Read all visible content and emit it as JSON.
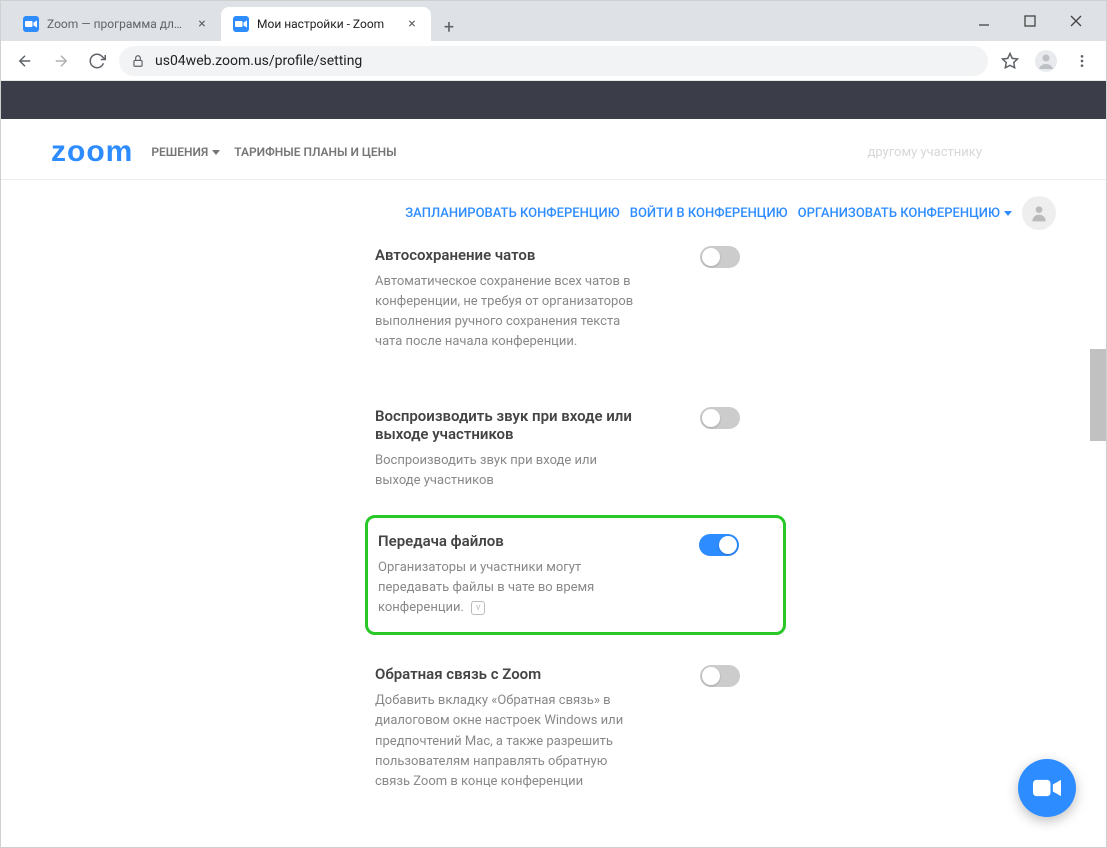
{
  "browser": {
    "tabs": [
      {
        "title": "Zoom — программа для конфе",
        "active": false
      },
      {
        "title": "Мои настройки - Zoom",
        "active": true
      }
    ],
    "url": "us04web.zoom.us/profile/setting"
  },
  "header": {
    "logo": "zoom",
    "nav": {
      "solutions": "РЕШЕНИЯ",
      "pricing": "ТАРИФНЫЕ ПЛАНЫ И ЦЕНЫ"
    },
    "faded": "другому участнику"
  },
  "actions": {
    "schedule": "ЗАПЛАНИРОВАТЬ КОНФЕРЕНЦИЮ",
    "join": "ВОЙТИ В КОНФЕРЕНЦИЮ",
    "host": "ОРГАНИЗОВАТЬ КОНФЕРЕНЦИЮ"
  },
  "settings": {
    "autosave": {
      "title": "Автосохранение чатов",
      "desc": "Автоматическое сохранение всех чатов в конференции, не требуя от организаторов выполнения ручного сохранения текста чата после начала конференции.",
      "enabled": false
    },
    "sound": {
      "title": "Воспроизводить звук при входе или выходе участников",
      "desc": "Воспроизводить звук при входе или выходе участников",
      "enabled": false
    },
    "file_transfer": {
      "title": "Передача файлов",
      "desc": "Организаторы и участники могут передавать файлы в чате во время конференции.",
      "enabled": true
    },
    "feedback": {
      "title": "Обратная связь с Zoom",
      "desc": "Добавить вкладку «Обратная связь» в диалоговом окне настроек Windows или предпочтений Mac, а также разрешить пользователям направлять обратную связь Zoom в конце конференции",
      "enabled": false
    }
  }
}
